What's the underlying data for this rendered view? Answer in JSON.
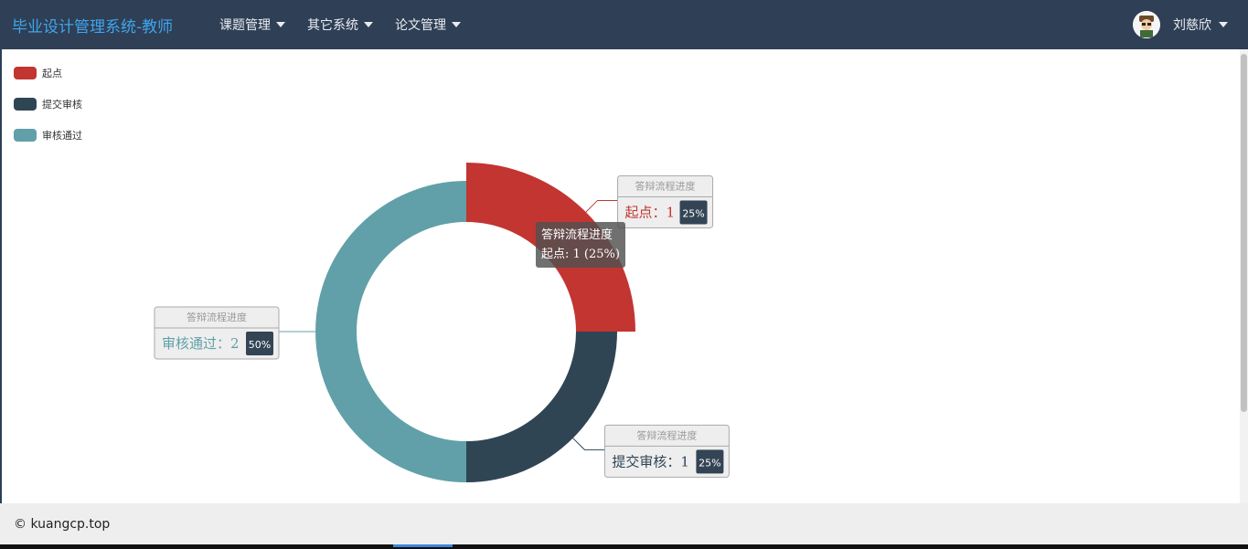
{
  "navbar": {
    "brand": "毕业设计管理系统-教师",
    "menus": [
      {
        "label": "课题管理"
      },
      {
        "label": "其它系统"
      },
      {
        "label": "论文管理"
      }
    ],
    "user_name": "刘慈欣"
  },
  "chart_data": {
    "type": "pie",
    "variant": "donut",
    "categories": [
      "起点",
      "提交审核",
      "审核通过"
    ],
    "values": [
      1,
      1,
      2
    ],
    "percents": [
      "25%",
      "25%",
      "50%"
    ],
    "colors": [
      "#c23531",
      "#2f4554",
      "#61a0a8"
    ],
    "series_name": "答辩流程进度",
    "legend_position": "top-left",
    "highlighted_slice": "起点"
  },
  "tooltip": {
    "title": "答辩流程进度",
    "text": "起点: 1 (25%)"
  },
  "footer": {
    "text": "© kuangcp.top"
  }
}
